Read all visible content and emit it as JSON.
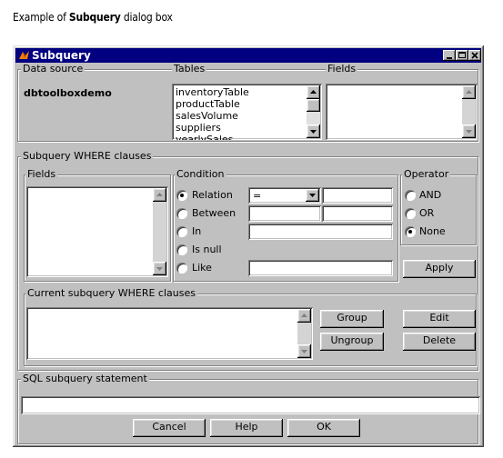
{
  "caption": {
    "prefix": "Example of ",
    "bold": "Subquery",
    "suffix": " dialog box"
  },
  "window": {
    "title": "Subquery"
  },
  "data_source": {
    "label": "Data source",
    "value": "dbtoolboxdemo"
  },
  "tables": {
    "label": "Tables",
    "items": [
      "inventoryTable",
      "productTable",
      "salesVolume",
      "suppliers",
      "yearlySales"
    ]
  },
  "fields_top": {
    "label": "Fields"
  },
  "where_group": {
    "label": "Subquery WHERE clauses"
  },
  "fields_where": {
    "label": "Fields"
  },
  "condition": {
    "label": "Condition",
    "options": [
      "Relation",
      "Between",
      "In",
      "Is null",
      "Like"
    ],
    "selected": "Relation",
    "relation_operator": "="
  },
  "operator": {
    "label": "Operator",
    "options": [
      "AND",
      "OR",
      "None"
    ],
    "selected": "None"
  },
  "apply_button": "Apply",
  "current_where": {
    "label": "Current subquery WHERE clauses"
  },
  "buttons": {
    "group": "Group",
    "ungroup": "Ungroup",
    "edit": "Edit",
    "delete": "Delete"
  },
  "sql_statement": {
    "label": "SQL subquery statement",
    "value": ""
  },
  "footer": {
    "cancel": "Cancel",
    "help": "Help",
    "ok": "OK"
  }
}
